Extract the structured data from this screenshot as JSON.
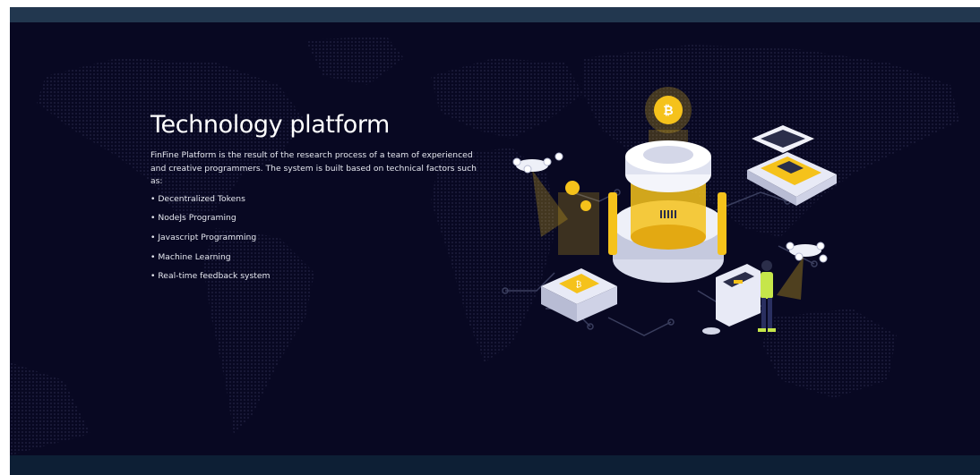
{
  "section": {
    "title": "Technology platform",
    "description": "FinFine Platform is the result of the research process of a team of experienced and creative programmers. The system is built based on technical factors such as:",
    "features": [
      "• Decentralized Tokens",
      "• NodeJs Programing",
      "• Javascript Programming",
      "• Machine Learning",
      "• Real-time feedback system"
    ]
  },
  "colors": {
    "top_bar": "#22374f",
    "section_background": "#080822",
    "bottom_bar": "#0d1f35",
    "accent_gold": "#f5c21b",
    "accent_yellow_green": "#c6e64a"
  },
  "icons": [
    "world-map-dots",
    "bitcoin-coin-icon",
    "drone-icon",
    "server-tower",
    "chip-board",
    "token-scale",
    "atm-terminal",
    "person-figure"
  ]
}
